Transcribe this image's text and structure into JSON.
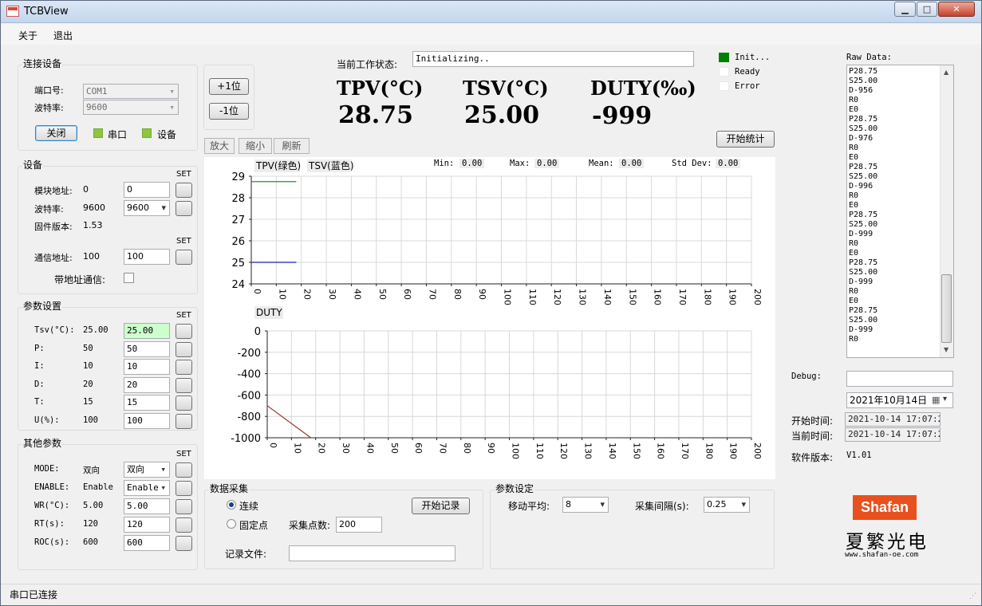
{
  "window": {
    "title": "TCBView",
    "min": "▁",
    "max": "□",
    "close": "✕"
  },
  "menu": [
    "关于",
    "退出"
  ],
  "connect": {
    "title": "连接设备",
    "port_label": "端口号:",
    "port_value": "COM1",
    "baud_label": "波特率:",
    "baud_value": "9600",
    "close_btn": "关闭",
    "serial_label": "串口",
    "device_label": "设备"
  },
  "adjust": {
    "plus": "+1位",
    "minus": "-1位"
  },
  "device": {
    "title": "设备",
    "set": "SET",
    "module_addr_label": "模块地址:",
    "module_addr_value": "0",
    "module_addr_input": "0",
    "baud_label": "波特率:",
    "baud_value": "9600",
    "baud_select": "9600",
    "fw_label": "固件版本:",
    "fw_value": "1.53",
    "comm_addr_label": "通信地址:",
    "comm_addr_value": "100",
    "comm_addr_input": "100",
    "with_addr_label": "带地址通信:"
  },
  "params": {
    "title": "参数设置",
    "set": "SET",
    "rows": [
      {
        "label": "Tsv(°C):",
        "value": "25.00",
        "input": "25.00"
      },
      {
        "label": "P:",
        "value": "50",
        "input": "50"
      },
      {
        "label": "I:",
        "value": "10",
        "input": "10"
      },
      {
        "label": "D:",
        "value": "20",
        "input": "20"
      },
      {
        "label": "T:",
        "value": "15",
        "input": "15"
      },
      {
        "label": "U(%):",
        "value": "100",
        "input": "100"
      }
    ]
  },
  "other": {
    "title": "其他参数",
    "set": "SET",
    "rows": [
      {
        "label": "MODE:",
        "value": "双向",
        "input": "双向"
      },
      {
        "label": "ENABLE:",
        "value": "Enable",
        "input": "Enable"
      },
      {
        "label": "WR(°C):",
        "value": "5.00",
        "input": "5.00"
      },
      {
        "label": "RT(s):",
        "value": "120",
        "input": "120"
      },
      {
        "label": "ROC(s):",
        "value": "600",
        "input": "600"
      }
    ]
  },
  "status": {
    "label": "当前工作状态:",
    "value": "Initializing.."
  },
  "readout": {
    "tpv_label": "TPV(°C)",
    "tpv_value": "28.75",
    "tsv_label": "TSV(°C)",
    "tsv_value": "25.00",
    "duty_label": "DUTY(‰)",
    "duty_value": "-999"
  },
  "indicators": [
    {
      "label": "Init...",
      "color": "#007f00"
    },
    {
      "label": "Ready",
      "color": "#ffffff"
    },
    {
      "label": "Error",
      "color": "#ffffff"
    }
  ],
  "start_stats": "开始统计",
  "chart_buttons": [
    "放大",
    "缩小",
    "刷新"
  ],
  "chart_stats": {
    "min_label": "Min:",
    "min_value": "0.00",
    "max_label": "Max:",
    "max_value": "0.00",
    "mean_label": "Mean:",
    "mean_value": "0.00",
    "std_label": "Std Dev:",
    "std_value": "0.00"
  },
  "chart_data": [
    {
      "type": "line",
      "legend": [
        "TPV(绿色)",
        "TSV(蓝色)"
      ],
      "xlim": [
        0,
        200
      ],
      "ylim": [
        24,
        29
      ],
      "xticks": [
        0,
        10,
        20,
        30,
        40,
        50,
        60,
        70,
        80,
        90,
        100,
        110,
        120,
        130,
        140,
        150,
        160,
        170,
        180,
        190,
        200
      ],
      "yticks": [
        29,
        28,
        27,
        26,
        25,
        24
      ],
      "grid": true,
      "series": [
        {
          "name": "TPV(绿色)",
          "color": "#2e8b2e",
          "x": [
            0,
            18
          ],
          "y": [
            28.75,
            28.75
          ]
        },
        {
          "name": "TSV(蓝色)",
          "color": "#1f1fb4",
          "x": [
            0,
            18
          ],
          "y": [
            25,
            25
          ]
        }
      ]
    },
    {
      "type": "line",
      "title": "DUTY",
      "xlim": [
        0,
        200
      ],
      "ylim": [
        -1000,
        0
      ],
      "xticks": [
        0,
        10,
        20,
        30,
        40,
        50,
        60,
        70,
        80,
        90,
        100,
        110,
        120,
        130,
        140,
        150,
        160,
        170,
        180,
        190,
        200
      ],
      "yticks": [
        0,
        -200,
        -400,
        -600,
        -800,
        -1000
      ],
      "grid": true,
      "series": [
        {
          "name": "DUTY",
          "color": "#a03030",
          "x": [
            0,
            18
          ],
          "y": [
            -700,
            -1000
          ]
        }
      ]
    }
  ],
  "acquisition": {
    "title": "数据采集",
    "continuous": "连续",
    "fixed": "固定点",
    "points_label": "采集点数:",
    "points_value": "200",
    "record_btn": "开始记录",
    "file_label": "记录文件:",
    "file_value": ""
  },
  "param_set": {
    "title": "参数设定",
    "avg_label": "移动平均:",
    "avg_value": "8",
    "interval_label": "采集间隔(s):",
    "interval_value": "0.25"
  },
  "raw": {
    "label": "Raw Data:",
    "lines": [
      "P28.75",
      "S25.00",
      "D-956",
      "R0",
      "E0",
      "P28.75",
      "S25.00",
      "D-976",
      "R0",
      "E0",
      "P28.75",
      "S25.00",
      "D-996",
      "R0",
      "E0",
      "P28.75",
      "S25.00",
      "D-999",
      "R0",
      "E0",
      "P28.75",
      "S25.00",
      "D-999",
      "R0",
      "E0",
      "P28.75",
      "S25.00",
      "D-999",
      "R0"
    ]
  },
  "debug": {
    "label": "Debug:",
    "value": ""
  },
  "date_picker": "2021年10月14日",
  "start_time_label": "开始时间:",
  "start_time": "2021-10-14 17:07:22",
  "current_time_label": "当前时间:",
  "current_time": "2021-10-14 17:07:29",
  "version_label": "软件版本:",
  "version": "V1.01",
  "logo": {
    "brand": "Shafan",
    "name": "夏繁光电",
    "url": "www.shafan-oe.com",
    "color": "#e8501e"
  },
  "statusbar": "串口已连接"
}
